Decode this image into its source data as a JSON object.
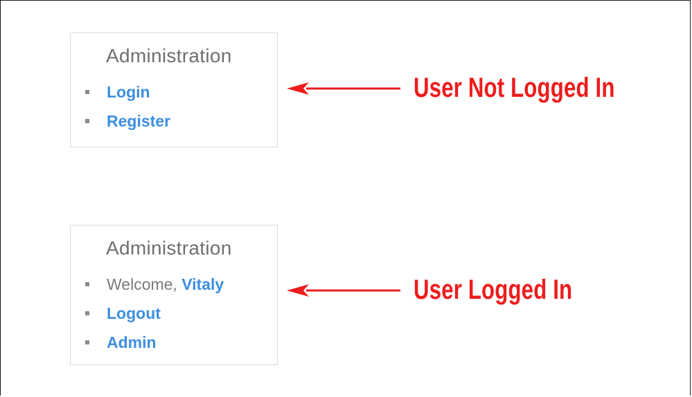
{
  "widget_logged_out": {
    "title": "Administration",
    "items": [
      {
        "label": "Login"
      },
      {
        "label": "Register"
      }
    ]
  },
  "widget_logged_in": {
    "title": "Administration",
    "welcome_prefix": "Welcome,",
    "username": "Vitaly",
    "items": [
      {
        "label": "Logout"
      },
      {
        "label": "Admin"
      }
    ]
  },
  "annotations": {
    "not_logged_in": "User Not Logged In",
    "logged_in": "User Logged In"
  },
  "colors": {
    "link": "#3d8ee0",
    "title": "#6f6f6f",
    "annotation": "#ee1c1c",
    "border": "#d9d9d9"
  },
  "icons": {
    "bullet": "square-bullet-icon",
    "arrow": "left-arrow-icon"
  }
}
